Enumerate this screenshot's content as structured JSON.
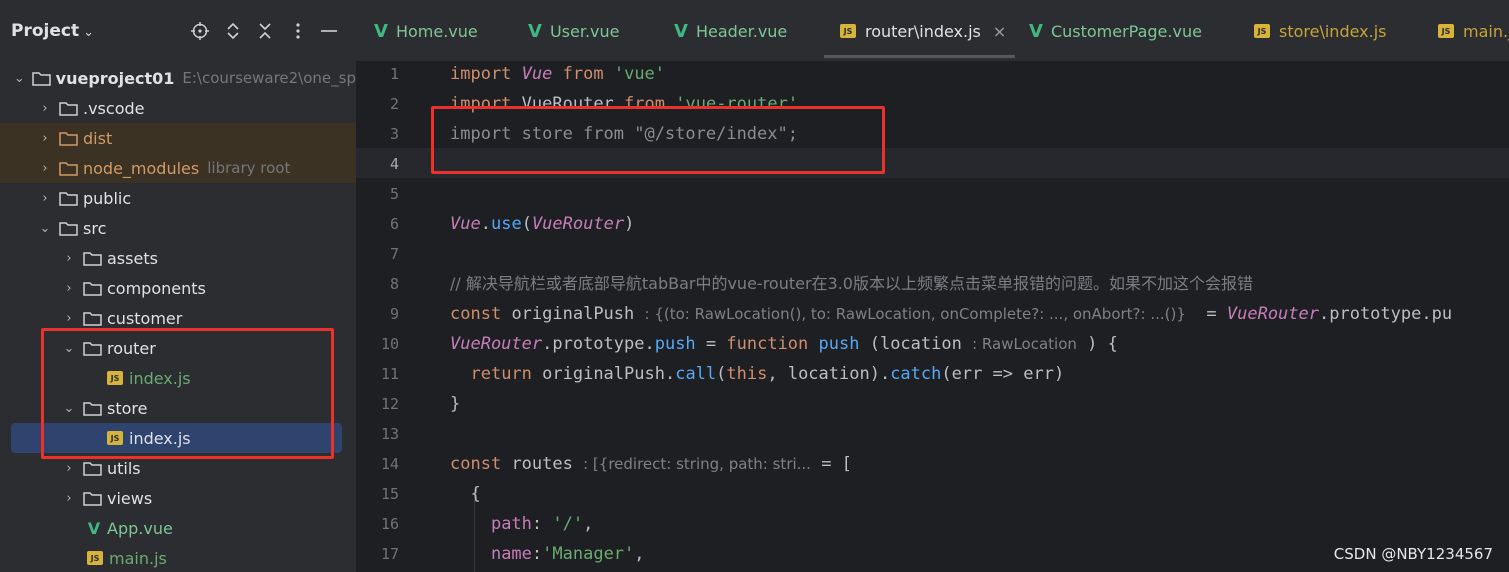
{
  "project": {
    "title": "Project",
    "chevron": "⌄",
    "header_icons": [
      "crosshair-icon",
      "expand-icon",
      "collapse-icon",
      "more-icon",
      "minimize-icon"
    ],
    "tree": [
      {
        "label": "vueproject01",
        "hint": "E:\\courseware2\\one_sp",
        "type": "folder",
        "expanded": true
      },
      {
        "label": ".vscode",
        "type": "folder",
        "expanded": false
      },
      {
        "label": "dist",
        "type": "folder",
        "expanded": false
      },
      {
        "label": "node_modules",
        "hint": "library root",
        "type": "folder",
        "expanded": false
      },
      {
        "label": "public",
        "type": "folder",
        "expanded": false
      },
      {
        "label": "src",
        "type": "folder",
        "expanded": true
      },
      {
        "label": "assets",
        "type": "folder",
        "expanded": false
      },
      {
        "label": "components",
        "type": "folder",
        "expanded": false
      },
      {
        "label": "customer",
        "type": "folder",
        "expanded": false
      },
      {
        "label": "router",
        "type": "folder",
        "expanded": true
      },
      {
        "label": "index.js",
        "type": "js"
      },
      {
        "label": "store",
        "type": "folder",
        "expanded": true
      },
      {
        "label": "index.js",
        "type": "js"
      },
      {
        "label": "utils",
        "type": "folder",
        "expanded": false
      },
      {
        "label": "views",
        "type": "folder",
        "expanded": false
      },
      {
        "label": "App.vue",
        "type": "vue"
      },
      {
        "label": "main.js",
        "type": "js"
      }
    ]
  },
  "tabs": [
    {
      "label": "Home.vue",
      "type": "vue"
    },
    {
      "label": "User.vue",
      "type": "vue"
    },
    {
      "label": "Header.vue",
      "type": "vue"
    },
    {
      "label": "router\\index.js",
      "type": "js",
      "active": true,
      "close": "×"
    },
    {
      "label": "CustomerPage.vue",
      "type": "vue"
    },
    {
      "label": "store\\index.js",
      "type": "js"
    },
    {
      "label": "main.js",
      "type": "js"
    }
  ],
  "editor": {
    "line_numbers": [
      "1",
      "2",
      "3",
      "4",
      "5",
      "6",
      "7",
      "8",
      "9",
      "10",
      "11",
      "12",
      "13",
      "14",
      "15",
      "16",
      "17"
    ],
    "line1": {
      "kw": "import",
      "cls": "Vue",
      "from": "from",
      "str": "'vue'"
    },
    "line2": {
      "kw": "import",
      "name": "VueRouter",
      "from": "from",
      "str": "'vue-router'"
    },
    "line3": {
      "text": "import store from \"@/store/index\";"
    },
    "line6": {
      "cls": "Vue",
      "dot": ".",
      "fn": "use",
      "open": "(",
      "arg": "VueRouter",
      "close": ")"
    },
    "line8": {
      "comment": "// 解决导航栏或者底部导航tabBar中的vue-router在3.0版本以上频繁点击菜单报错的问题。如果不加这个会报错"
    },
    "line9": {
      "kw": "const",
      "name": "originalPush",
      "inlay": ": {(to: RawLocation(), to: RawLocation, onComplete?: ..., onAbort?: ...()}",
      "eq": "=",
      "cls": "VueRouter",
      "rest": ".prototype.pu"
    },
    "line10": {
      "cls": "VueRouter",
      "mid": ".prototype.",
      "prop": "push",
      "eq": " = ",
      "kw": "function",
      "fn": "push",
      "open": " (location",
      "inlay": ": RawLocation",
      "close": " ) {"
    },
    "line11": {
      "kw": "return",
      "pre": " originalPush.",
      "fn1": "call",
      "mid1": "(",
      "kw2": "this",
      "mid2": ", location).",
      "fn2": "catch",
      "rest": "(err => err)"
    },
    "line12": {
      "text": "}"
    },
    "line14": {
      "kw": "const",
      "name": "routes",
      "inlay": ": [{redirect: string, path: stri...",
      "rest": " = ["
    },
    "line15": {
      "text": "{"
    },
    "line16": {
      "prop": "path",
      "colon": ": ",
      "str": "'/'",
      "comma": ","
    },
    "line17": {
      "prop": "name",
      "colon": ":",
      "str": "'Manager'",
      "comma": ","
    }
  },
  "watermark": "CSDN @NBY1234567"
}
